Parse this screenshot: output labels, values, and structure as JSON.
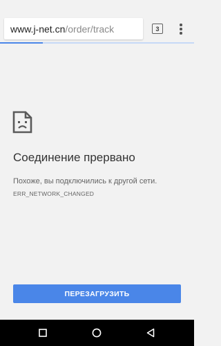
{
  "toolbar": {
    "url_host": "www.j-net.cn",
    "url_path": "/order/track",
    "tab_count": "3",
    "menu_icon": "more-vert-icon",
    "progress": 0.22,
    "progress_color": "#4a86e8"
  },
  "error_page": {
    "icon": "sad-tab-icon",
    "title": "Соединение прервано",
    "message": "Похоже, вы подключились к другой сети.",
    "code": "ERR_NETWORK_CHANGED",
    "reload_label": "ПЕРЕЗАГРУЗИТЬ",
    "accent_color": "#4a86e8"
  },
  "navbar": {
    "buttons": [
      "recents-icon",
      "home-icon",
      "back-icon"
    ]
  }
}
